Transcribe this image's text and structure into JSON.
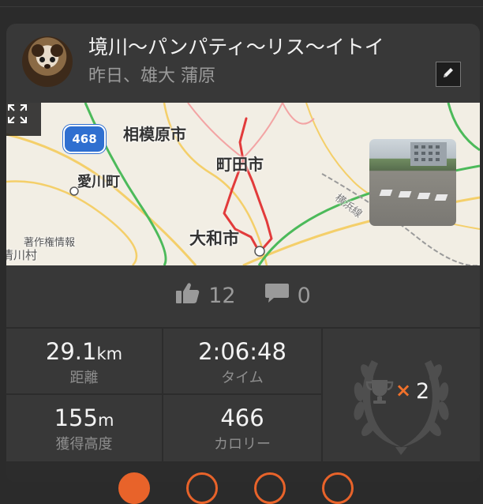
{
  "activity": {
    "title": "境川〜パンパティ〜リス〜イトイ",
    "subtitle": "昨日、雄大 蒲原"
  },
  "map": {
    "places": [
      "相模原市",
      "町田市",
      "愛川町",
      "大和市",
      "横浜線",
      "著作権情報",
      "清川村"
    ],
    "route_number": "468"
  },
  "social": {
    "likes": "12",
    "comments": "0"
  },
  "stats": {
    "distance": {
      "value": "29.1",
      "unit": "km",
      "label": "距離"
    },
    "time": {
      "value": "2:06:48",
      "label": "タイム"
    },
    "elevation": {
      "value": "155",
      "unit": "m",
      "label": "獲得高度"
    },
    "calories": {
      "value": "466",
      "label": "カロリー"
    },
    "achievements": {
      "times": "×",
      "count": "2"
    }
  },
  "colors": {
    "accent": "#e8632a",
    "route": "#e23b3b",
    "highway_shield": "#2f6fd0"
  },
  "icons": [
    "expand-icon",
    "pencil-icon",
    "thumbs-up-icon",
    "comment-icon",
    "trophy-icon",
    "laurel-icon"
  ]
}
